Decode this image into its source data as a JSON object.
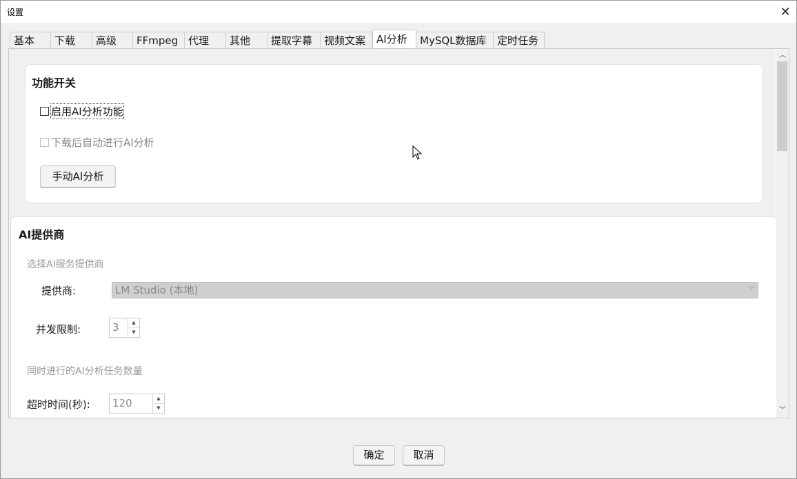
{
  "window": {
    "title": "设置",
    "close_icon": "close-icon"
  },
  "tabs": [
    {
      "label": "基本"
    },
    {
      "label": "下载"
    },
    {
      "label": "高级"
    },
    {
      "label": "FFmpeg"
    },
    {
      "label": "代理"
    },
    {
      "label": "其他"
    },
    {
      "label": "提取字幕"
    },
    {
      "label": "视频文案"
    },
    {
      "label": "AI分析",
      "active": true
    },
    {
      "label": "MySQL数据库"
    },
    {
      "label": "定时任务"
    }
  ],
  "feature_group": {
    "title": "功能开关",
    "enable_ai": {
      "label": "启用AI分析功能",
      "checked": false
    },
    "auto_analyze": {
      "label": "下载后自动进行AI分析",
      "checked": false,
      "enabled": false
    },
    "manual_button": "手动AI分析"
  },
  "provider_group": {
    "title": "AI提供商",
    "hint": "选择AI服务提供商",
    "provider_label": "提供商:",
    "provider_value": "LM Studio (本地)",
    "concurrency_label": "并发限制:",
    "concurrency_value": "3",
    "concurrency_hint": "同时进行的AI分析任务数量",
    "timeout_label": "超时时间(秒):",
    "timeout_value": "120"
  },
  "footer": {
    "ok": "确定",
    "cancel": "取消"
  }
}
